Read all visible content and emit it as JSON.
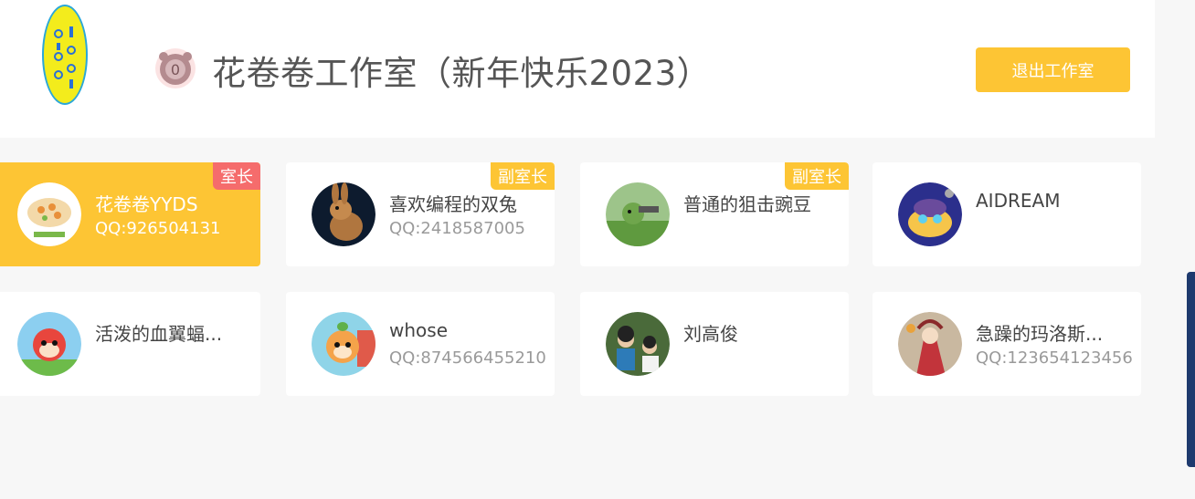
{
  "header": {
    "title": "花卷卷工作室（新年快乐2023）",
    "level_badge": "0",
    "exit_label": "退出工作室"
  },
  "members": [
    {
      "name": "花卷卷YYDS",
      "qq": "QQ:926504131",
      "role": "室长",
      "selected": true
    },
    {
      "name": "喜欢编程的双兔",
      "qq": "QQ:2418587005",
      "role": "副室长"
    },
    {
      "name": "普通的狙击豌豆",
      "qq": "",
      "role": "副室长"
    },
    {
      "name": "AIDREAM",
      "qq": "",
      "role": ""
    },
    {
      "name": "活泼的血翼蝠...",
      "qq": "",
      "role": ""
    },
    {
      "name": "whose",
      "qq": "QQ:874566455210",
      "role": ""
    },
    {
      "name": "刘高俊",
      "qq": "",
      "role": ""
    },
    {
      "name": "急躁的玛洛斯...",
      "qq": "QQ:123654123456",
      "role": ""
    }
  ],
  "colors": {
    "accent": "#fdc534",
    "owner_badge": "#f56c6c",
    "background": "#f7f7f7"
  }
}
